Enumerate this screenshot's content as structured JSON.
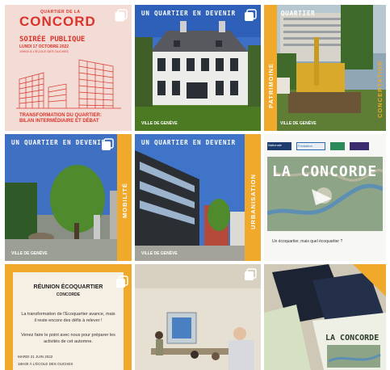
{
  "tiles": {
    "t1": {
      "kicker": "QUARTIER DE LA",
      "title": "CONCORD",
      "event": "SOIRÉE PUBLIQUE",
      "date": "LUNDI 17 OCTOBRE 2022",
      "place": "19H00 À L'ÉCOLE DES OUCHES",
      "headline1": "TRANSFORMATION DU QUARTIER:",
      "headline2": "BILAN INTERMÉDIAIRE ET DÉBAT"
    },
    "t2": {
      "header": "UN QUARTIER EN DEVENIR",
      "logo": "VILLE DE GENÈVE"
    },
    "t3": {
      "header": "UN QUARTIER",
      "side": "PATRIMOINE",
      "side2": "CONCERTATION",
      "logo": "VILLE DE GENÈVE"
    },
    "t4": {
      "header": "UN QUARTIER EN DEVENIR",
      "side": "MOBILITÉ",
      "logo": "VILLE DE GENÈVE"
    },
    "t5": {
      "header": "UN QUARTIER EN DEVENIR",
      "side": "URBANISATION",
      "logo": "VILLE DE GENÈVE"
    },
    "t6": {
      "partners": [
        "Nationale",
        "Fondation",
        "",
        ""
      ],
      "title": "LA CONCORDE",
      "caption": "Un écoquartier, mais quel écoquartier ?"
    },
    "t7": {
      "title": "RÉUNION ÉCOQUARTIER",
      "subtitle": "CONCORDE",
      "p1": "La transformation de l'Ecoquartier avance, mais il reste encore des défis à relever !",
      "p2": "Venez faire le point avec nous pour préparer les activités de cet automne.",
      "date": "MARDI 21 JUIN 2022",
      "time": "18H30 À L'ÉCOLE DES OUCHES"
    },
    "t8": {},
    "t9": {
      "title": "LA CONCORDE"
    }
  },
  "colors": {
    "red": "#d9342b",
    "orange": "#f0a92b",
    "pink": "#f3dcd5",
    "cream": "#f6efe3"
  }
}
